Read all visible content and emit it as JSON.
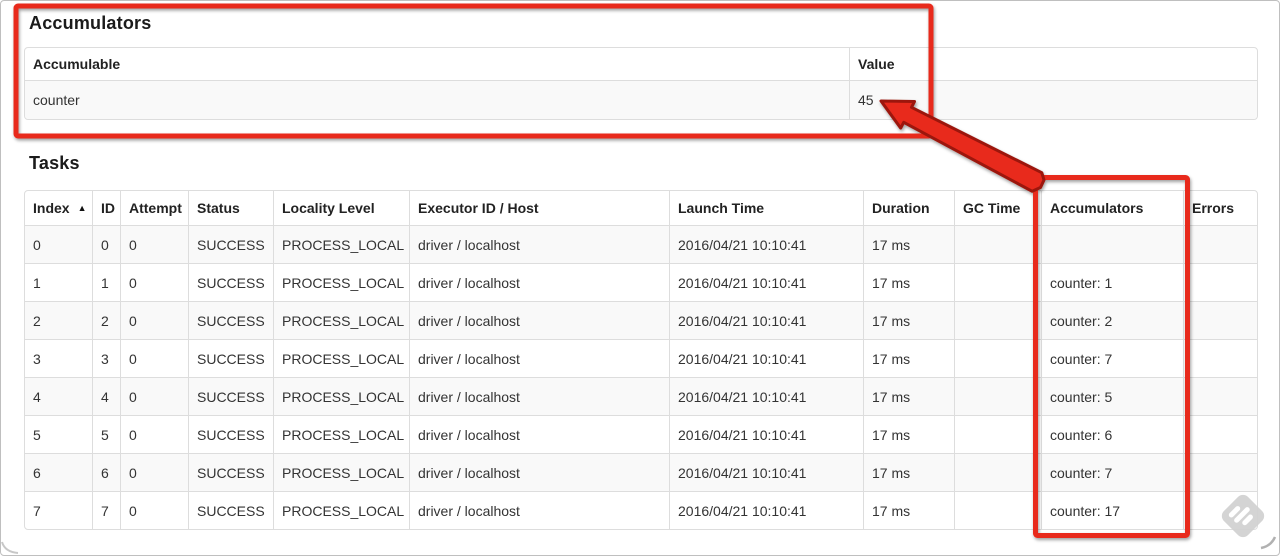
{
  "accumulators_section": {
    "title": "Accumulators",
    "table": {
      "headers": [
        "Accumulable",
        "Value"
      ],
      "rows": [
        {
          "accumulable": "counter",
          "value": "45"
        }
      ]
    }
  },
  "tasks_section": {
    "title": "Tasks",
    "table": {
      "headers": [
        "Index",
        "ID",
        "Attempt",
        "Status",
        "Locality Level",
        "Executor ID / Host",
        "Launch Time",
        "Duration",
        "GC Time",
        "Accumulators",
        "Errors"
      ],
      "sort": {
        "column": "Index",
        "direction": "ascending",
        "icon": "▲"
      },
      "rows": [
        {
          "index": "0",
          "id": "0",
          "attempt": "0",
          "status": "SUCCESS",
          "locality": "PROCESS_LOCAL",
          "executor": "driver / localhost",
          "launch": "2016/04/21 10:10:41",
          "duration": "17 ms",
          "gc": "",
          "accumulators": "",
          "errors": ""
        },
        {
          "index": "1",
          "id": "1",
          "attempt": "0",
          "status": "SUCCESS",
          "locality": "PROCESS_LOCAL",
          "executor": "driver / localhost",
          "launch": "2016/04/21 10:10:41",
          "duration": "17 ms",
          "gc": "",
          "accumulators": "counter: 1",
          "errors": ""
        },
        {
          "index": "2",
          "id": "2",
          "attempt": "0",
          "status": "SUCCESS",
          "locality": "PROCESS_LOCAL",
          "executor": "driver / localhost",
          "launch": "2016/04/21 10:10:41",
          "duration": "17 ms",
          "gc": "",
          "accumulators": "counter: 2",
          "errors": ""
        },
        {
          "index": "3",
          "id": "3",
          "attempt": "0",
          "status": "SUCCESS",
          "locality": "PROCESS_LOCAL",
          "executor": "driver / localhost",
          "launch": "2016/04/21 10:10:41",
          "duration": "17 ms",
          "gc": "",
          "accumulators": "counter: 7",
          "errors": ""
        },
        {
          "index": "4",
          "id": "4",
          "attempt": "0",
          "status": "SUCCESS",
          "locality": "PROCESS_LOCAL",
          "executor": "driver / localhost",
          "launch": "2016/04/21 10:10:41",
          "duration": "17 ms",
          "gc": "",
          "accumulators": "counter: 5",
          "errors": ""
        },
        {
          "index": "5",
          "id": "5",
          "attempt": "0",
          "status": "SUCCESS",
          "locality": "PROCESS_LOCAL",
          "executor": "driver / localhost",
          "launch": "2016/04/21 10:10:41",
          "duration": "17 ms",
          "gc": "",
          "accumulators": "counter: 6",
          "errors": ""
        },
        {
          "index": "6",
          "id": "6",
          "attempt": "0",
          "status": "SUCCESS",
          "locality": "PROCESS_LOCAL",
          "executor": "driver / localhost",
          "launch": "2016/04/21 10:10:41",
          "duration": "17 ms",
          "gc": "",
          "accumulators": "counter: 7",
          "errors": ""
        },
        {
          "index": "7",
          "id": "7",
          "attempt": "0",
          "status": "SUCCESS",
          "locality": "PROCESS_LOCAL",
          "executor": "driver / localhost",
          "launch": "2016/04/21 10:10:41",
          "duration": "17 ms",
          "gc": "",
          "accumulators": "counter: 17",
          "errors": ""
        }
      ]
    }
  },
  "annotations": {
    "highlight_color": "#e8291c",
    "outline_color": "#9c170a",
    "boxes": [
      "accumulators-summary-box",
      "accumulators-column-box"
    ],
    "arrow_target_value": "45"
  },
  "watermark": {
    "name": "skitch-watermark",
    "color": "#d2d2d2"
  }
}
